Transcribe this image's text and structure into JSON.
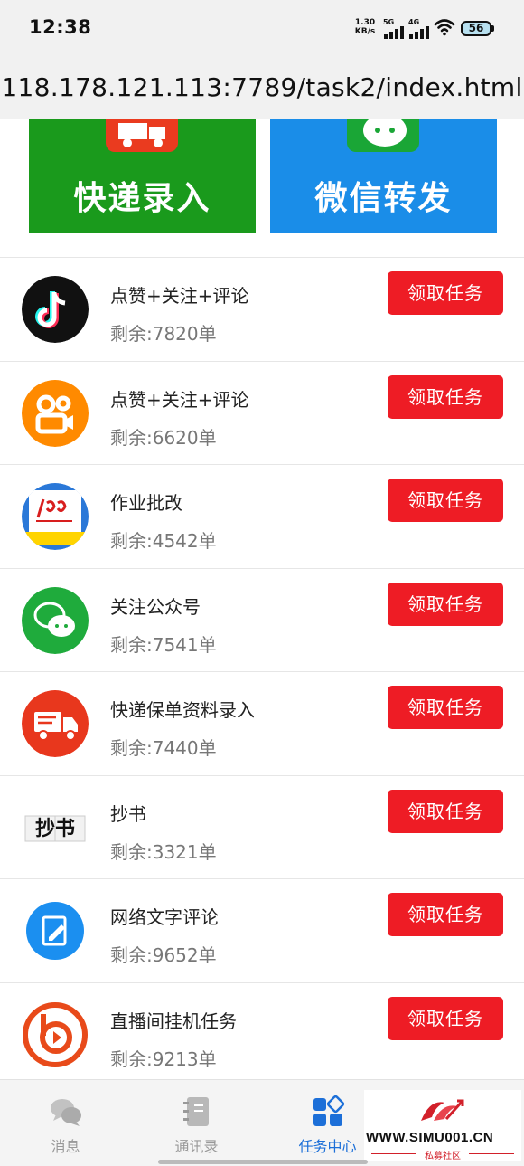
{
  "status_bar": {
    "time": "12:38",
    "net_speed_value": "1.30",
    "net_speed_unit": "KB/s",
    "signal_1_tag": "5G",
    "signal_2_tag": "4G",
    "battery": "56"
  },
  "browser": {
    "url": "118.178.121.113:7789/task2/index.html"
  },
  "banners": [
    {
      "label": "快递录入",
      "color": "#1a9a1c",
      "icon": "delivery-truck-icon"
    },
    {
      "label": "微信转发",
      "color": "#1a8de8",
      "icon": "wechat-icon"
    }
  ],
  "tasks": [
    {
      "icon": "douyin-icon",
      "title": "点赞+关注+评论",
      "remaining": "剩余:7820单",
      "button": "领取任务"
    },
    {
      "icon": "kuaishou-icon",
      "title": "点赞+关注+评论",
      "remaining": "剩余:6620单",
      "button": "领取任务"
    },
    {
      "icon": "homework-correction-icon",
      "title": "作业批改",
      "remaining": "剩余:4542单",
      "button": "领取任务"
    },
    {
      "icon": "wechat-official-account-icon",
      "title": "关注公众号",
      "remaining": "剩余:7541单",
      "button": "领取任务"
    },
    {
      "icon": "delivery-truck-icon",
      "title": "快递保单资料录入",
      "remaining": "剩余:7440单",
      "button": "领取任务"
    },
    {
      "icon": "copy-book-icon",
      "icon_text": "抄书",
      "title": "抄书",
      "remaining": "剩余:3321单",
      "button": "领取任务"
    },
    {
      "icon": "edit-note-icon",
      "title": "网络文字评论",
      "remaining": "剩余:9652单",
      "button": "领取任务"
    },
    {
      "icon": "live-stream-play-icon",
      "title": "直播间挂机任务",
      "remaining": "剩余:9213单",
      "button": "领取任务"
    }
  ],
  "bottom_nav": [
    {
      "label": "消息",
      "icon": "chat-bubbles-icon",
      "active": false
    },
    {
      "label": "通讯录",
      "icon": "contacts-book-icon",
      "active": false
    },
    {
      "label": "任务中心",
      "icon": "task-center-icon",
      "active": true
    }
  ],
  "watermark": {
    "site": "WWW.SIMU001.CN",
    "subtitle": "私募社区"
  },
  "colors": {
    "task_button": "#ee1c25",
    "active_nav": "#1c6fd8",
    "banner_green": "#1a9a1c",
    "banner_blue": "#1a8de8"
  }
}
